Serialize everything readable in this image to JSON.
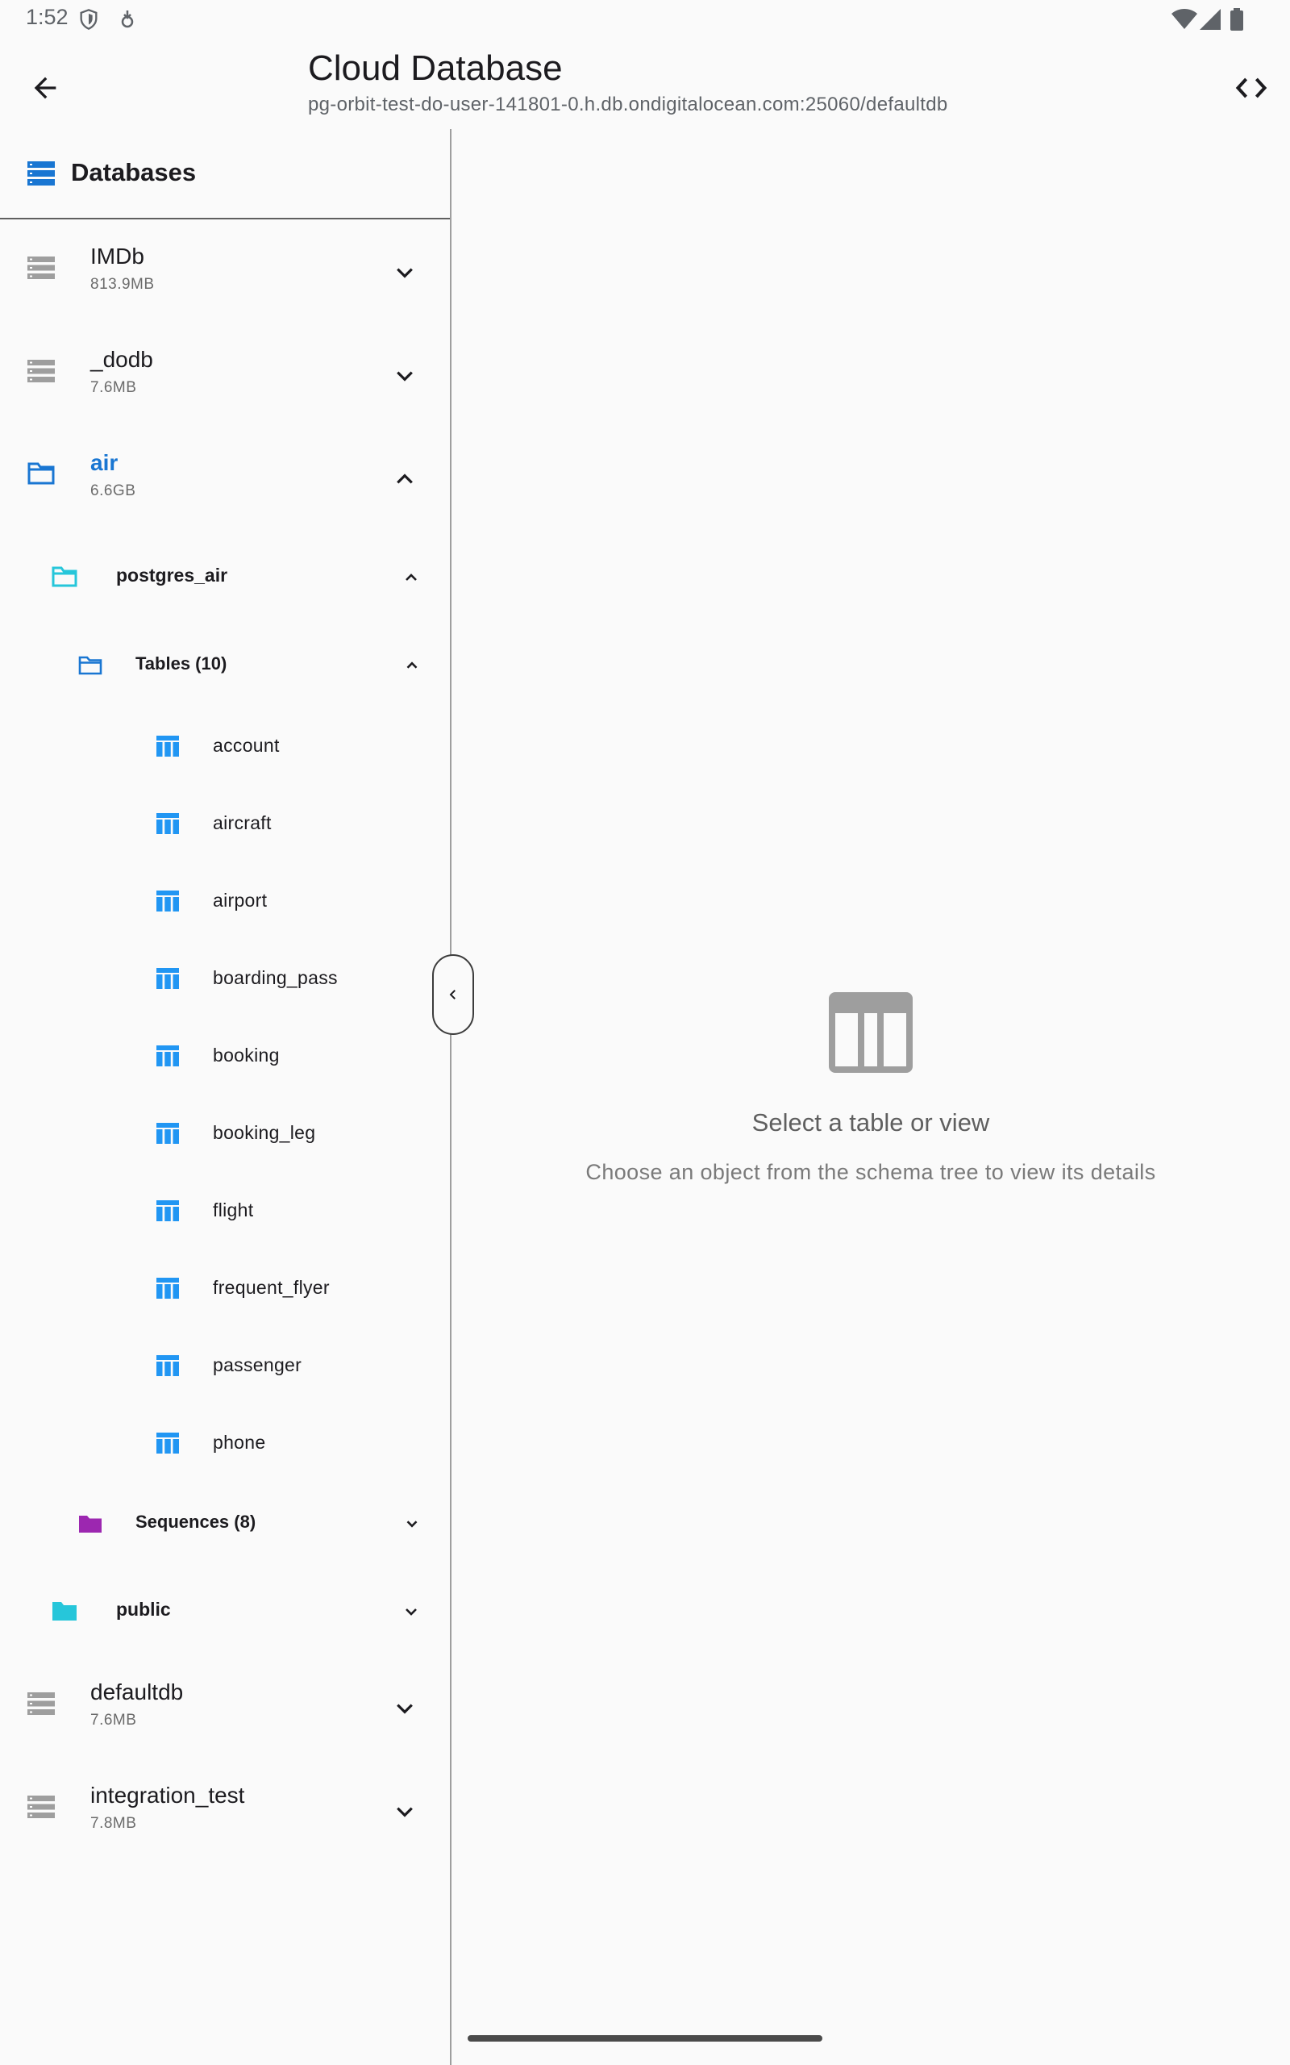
{
  "status_bar": {
    "time": "1:52",
    "icons": [
      "shield-icon",
      "data-saver-icon",
      "wifi-icon",
      "cellular-icon",
      "battery-icon"
    ]
  },
  "app_bar": {
    "title": "Cloud Database",
    "subtitle": "pg-orbit-test-do-user-141801-0.h.db.ondigitalocean.com:25060/defaultdb",
    "back_icon": "arrow-back-icon",
    "code_icon": "code-brackets-icon"
  },
  "sidebar": {
    "header": "Databases",
    "databases": [
      {
        "name": "IMDb",
        "size": "813.9MB",
        "expanded": false
      },
      {
        "name": "_dodb",
        "size": "7.6MB",
        "expanded": false
      },
      {
        "name": "air",
        "size": "6.6GB",
        "expanded": true,
        "schemas": [
          {
            "name": "postgres_air",
            "expanded": true,
            "groups": [
              {
                "label": "Tables (10)",
                "expanded": true,
                "items": [
                  "account",
                  "aircraft",
                  "airport",
                  "boarding_pass",
                  "booking",
                  "booking_leg",
                  "flight",
                  "frequent_flyer",
                  "passenger",
                  "phone"
                ]
              },
              {
                "label": "Sequences (8)",
                "expanded": false
              }
            ]
          },
          {
            "name": "public",
            "expanded": false
          }
        ]
      },
      {
        "name": "defaultdb",
        "size": "7.6MB",
        "expanded": false
      },
      {
        "name": "integration_test",
        "size": "7.8MB",
        "expanded": false
      }
    ]
  },
  "empty_state": {
    "icon": "table-icon",
    "title": "Select a table or view",
    "subtitle": "Choose an object from the schema tree to view its details"
  },
  "colors": {
    "accent": "#1976d2",
    "table_icon": "#2196f3",
    "schema_folder": "#26c6da",
    "sequences_folder": "#9c27b0",
    "db_icon": "#9e9e9e",
    "background": "#fafafa"
  }
}
